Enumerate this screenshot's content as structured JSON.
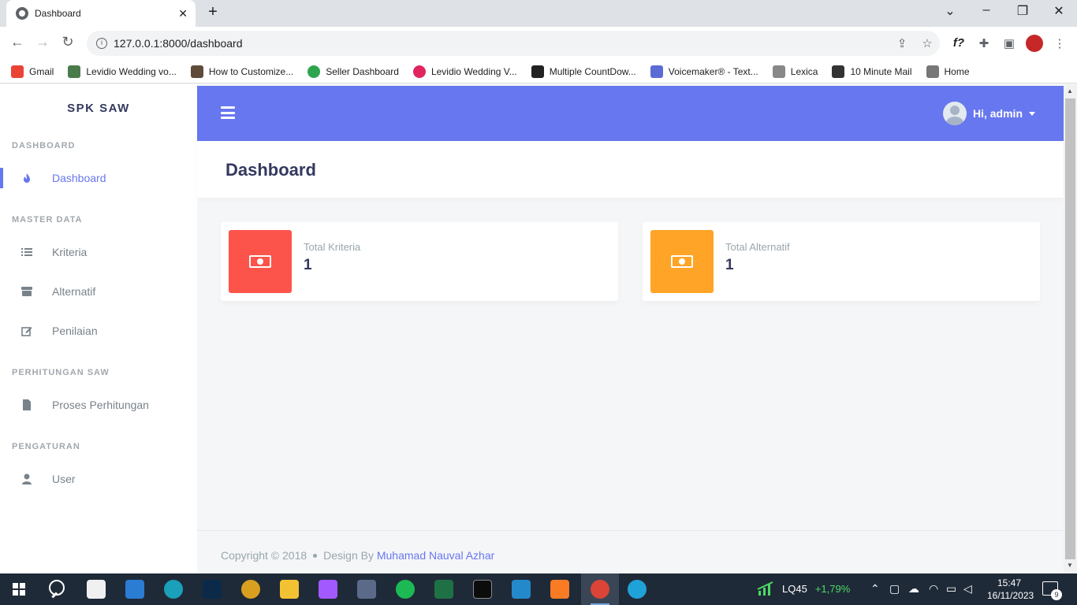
{
  "browser": {
    "tab_title": "Dashboard",
    "tab_close": "✕",
    "new_tab": "+",
    "url": "127.0.0.1:8000/dashboard",
    "bookmarks": [
      {
        "label": "Gmail",
        "color": "#ea4335"
      },
      {
        "label": "Levidio Wedding vo...",
        "color": "#4a7b4b"
      },
      {
        "label": "How to Customize...",
        "color": "#5f4b3a"
      },
      {
        "label": "Seller Dashboard",
        "color": "#2ea44f"
      },
      {
        "label": "Levidio Wedding V...",
        "color": "#e0245e"
      },
      {
        "label": "Multiple CountDow...",
        "color": "#222222"
      },
      {
        "label": "Voicemaker® - Text...",
        "color": "#5b6bd6"
      },
      {
        "label": "Lexica",
        "color": "#888888"
      },
      {
        "label": "10 Minute Mail",
        "color": "#333333"
      },
      {
        "label": "Home",
        "color": "#777777"
      }
    ]
  },
  "sidebar": {
    "brand": "SPK SAW",
    "sections": [
      {
        "header": "DASHBOARD",
        "items": [
          {
            "label": "Dashboard",
            "icon": "fire-icon",
            "active": true
          }
        ]
      },
      {
        "header": "MASTER DATA",
        "items": [
          {
            "label": "Kriteria",
            "icon": "list-icon"
          },
          {
            "label": "Alternatif",
            "icon": "box-icon"
          },
          {
            "label": "Penilaian",
            "icon": "edit-icon"
          }
        ]
      },
      {
        "header": "PERHITUNGAN SAW",
        "items": [
          {
            "label": "Proses Perhitungan",
            "icon": "file-icon"
          }
        ]
      },
      {
        "header": "PENGATURAN",
        "items": [
          {
            "label": "User",
            "icon": "user-icon"
          }
        ]
      }
    ]
  },
  "navbar": {
    "user_greeting": "Hi, admin",
    "accent_color": "#6777ef"
  },
  "main": {
    "title": "Dashboard",
    "cards": [
      {
        "label": "Total Kriteria",
        "value": "1",
        "color": "#fc544b",
        "icon": "money-bill-icon"
      },
      {
        "label": "Total Alternatif",
        "value": "1",
        "color": "#ffa426",
        "icon": "money-bill-icon"
      }
    ]
  },
  "footer": {
    "copyright": "Copyright © 2018",
    "design_by": "Design By",
    "author": "Muhamad Nauval Azhar"
  },
  "taskbar": {
    "ticker_symbol": "LQ45",
    "ticker_change": "+1,79%",
    "time": "15:47",
    "date": "16/11/2023",
    "notification_count": "9"
  }
}
